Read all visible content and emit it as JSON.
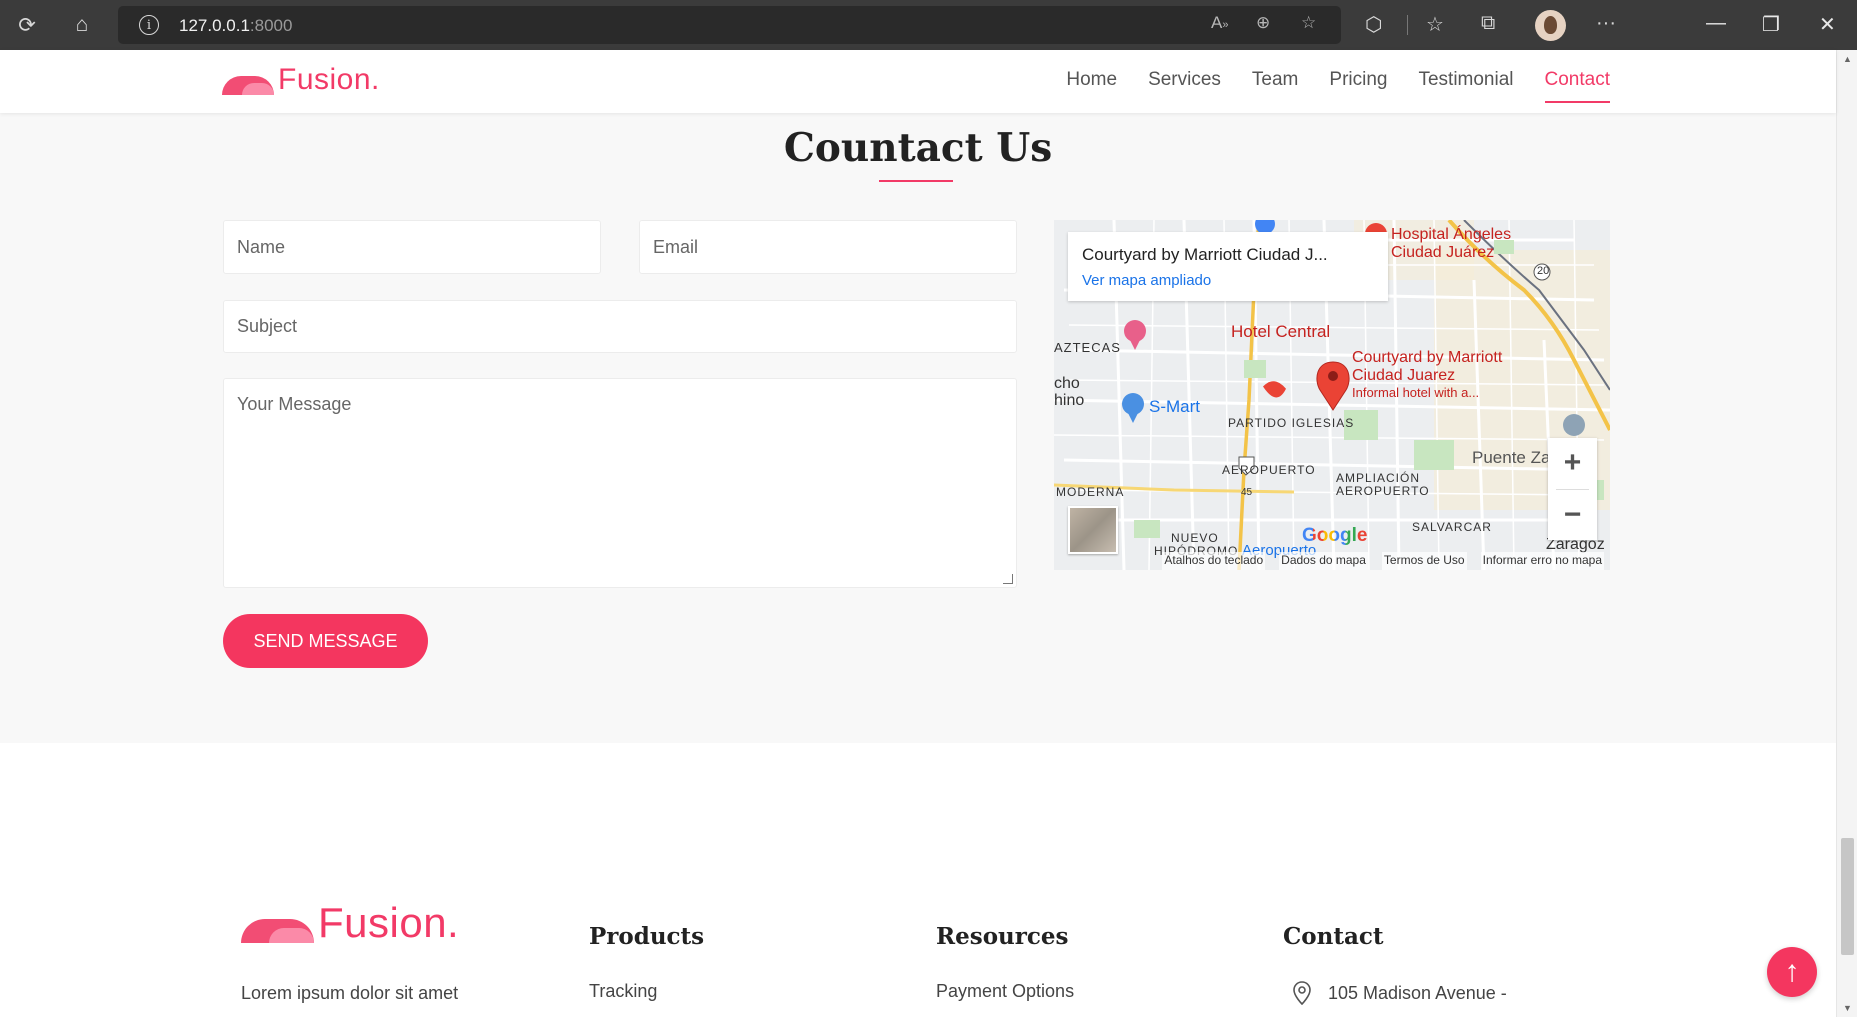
{
  "browser": {
    "url_host": "127.0.0.1",
    "url_port": ":8000",
    "icons": [
      "reload-icon",
      "home-icon",
      "info-icon",
      "read-aloud-icon",
      "zoom-icon",
      "favorite-add-icon",
      "extensions-icon",
      "favorites-icon",
      "collections-icon",
      "profile-avatar",
      "more-icon",
      "minimize-icon",
      "restore-icon",
      "close-icon"
    ]
  },
  "header": {
    "logo_text": "Fusion.",
    "nav": [
      {
        "label": "Home",
        "active": false
      },
      {
        "label": "Services",
        "active": false
      },
      {
        "label": "Team",
        "active": false
      },
      {
        "label": "Pricing",
        "active": false
      },
      {
        "label": "Testimonial",
        "active": false
      },
      {
        "label": "Contact",
        "active": true
      }
    ]
  },
  "contact": {
    "title": "Countact Us",
    "name_placeholder": "Name",
    "email_placeholder": "Email",
    "subject_placeholder": "Subject",
    "message_placeholder": "Your Message",
    "send_label": "SEND MESSAGE"
  },
  "map": {
    "card_place": "Courtyard by Marriott Ciudad J...",
    "card_link": "Ver mapa ampliado",
    "labels": {
      "hospital_line1": "Hospital Ángeles",
      "hospital_line2": "Ciudad Juárez",
      "hotel_central": "Hotel Central",
      "aztecas": "AZTECAS",
      "cho": "cho",
      "hino": "hino",
      "smart": "S-Mart",
      "courtyard_line1": "Courtyard by Marriott",
      "courtyard_line2": "Ciudad Juarez",
      "courtyard_line3": "Informal hotel with a...",
      "partido": "PARTIDO IGLESIAS",
      "puente": "Puente Za",
      "aeropuerto": "AEROPUERTO",
      "ampliacion1": "AMPLIACIÓN",
      "ampliacion2": "AEROPUERTO",
      "moderna": "MODERNA",
      "nuevo1": "NUEVO",
      "nuevo2": "HIPÓDROMO",
      "aeropuerto2": "Aeropuerto",
      "salvarcar": "SALVARCAR",
      "zaragoz": "Zaragoz",
      "route20": "20",
      "route45": "45"
    },
    "google": "Google",
    "footer": [
      "Atalhos do teclado",
      "Dados do mapa",
      "Termos de Uso",
      "Informar erro no mapa"
    ],
    "colors": {
      "pin": "#ea4335",
      "poi_text": "#c5221f",
      "shop": "#1a73e8",
      "hotel_pin": "#e8608a",
      "highway": "#f3c348",
      "park": "#c8e6c0"
    }
  },
  "footer": {
    "logo_text": "Fusion.",
    "about": "Lorem ipsum dolor sit amet",
    "columns": [
      {
        "heading": "Products",
        "first_link": "Tracking"
      },
      {
        "heading": "Resources",
        "first_link": "Payment Options"
      },
      {
        "heading": "Contact",
        "first_link": "105 Madison Avenue -"
      }
    ]
  },
  "scroll_top_icon": "arrow-up-icon",
  "accent_color": "#f23a67"
}
